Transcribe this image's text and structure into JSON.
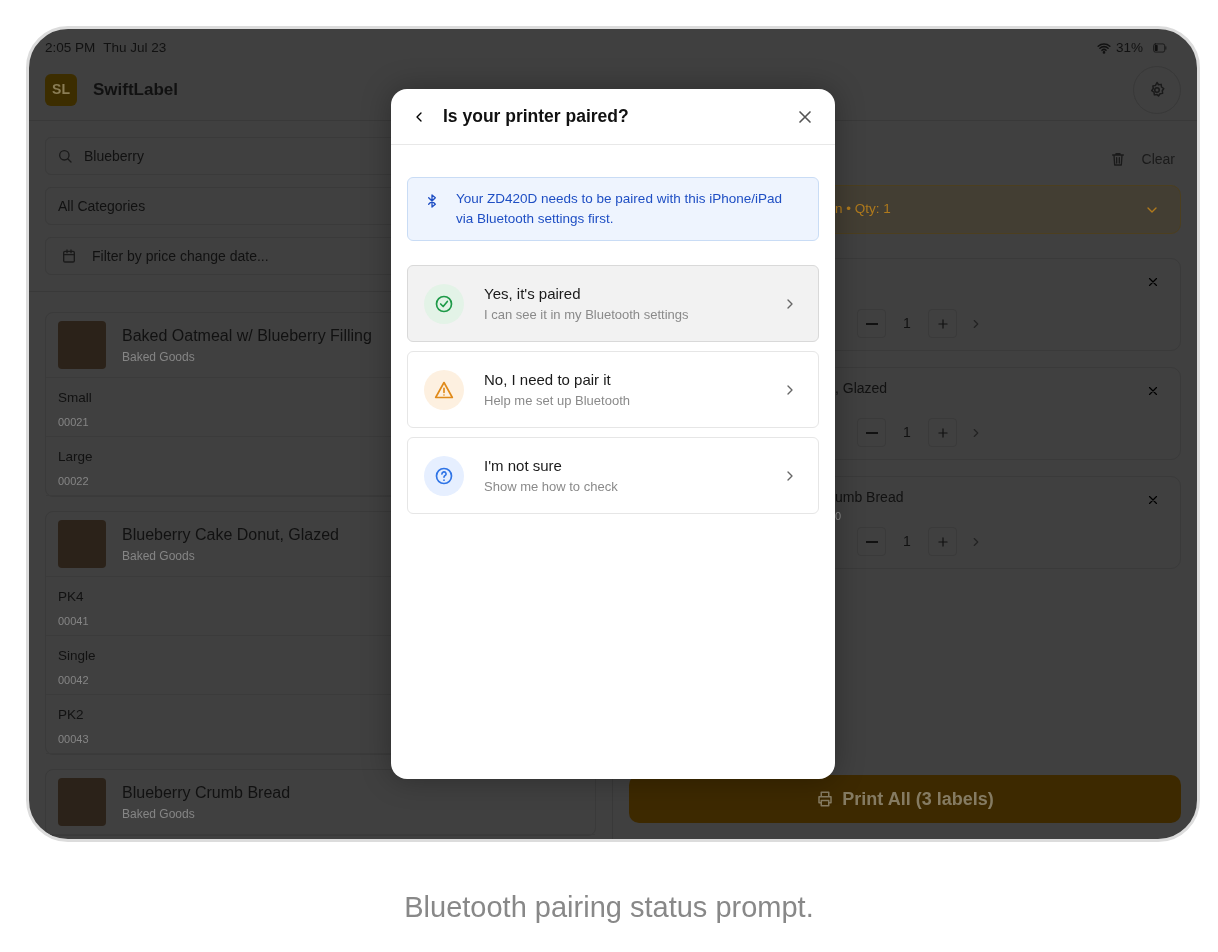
{
  "status_bar": {
    "time": "2:05 PM",
    "date": "Thu Jul 23",
    "battery": "31%"
  },
  "app": {
    "logo_text": "SL",
    "title": "SwiftLabel"
  },
  "filters": {
    "search": {
      "value": "Blueberry"
    },
    "category": {
      "value": "All Categories"
    },
    "date_filter": {
      "placeholder": "Filter by price change date..."
    }
  },
  "products": [
    {
      "name": "Baked Oatmeal w/ Blueberry Filling",
      "category": "Baked Goods",
      "variants": [
        {
          "name": "Small",
          "code": "00021"
        },
        {
          "name": "Large",
          "code": "00022"
        }
      ]
    },
    {
      "name": "Blueberry Cake Donut, Glazed",
      "category": "Baked Goods",
      "variants": [
        {
          "name": "PK4",
          "code": "00041"
        },
        {
          "name": "Single",
          "code": "00042"
        },
        {
          "name": "PK2",
          "code": "00043"
        }
      ]
    },
    {
      "name": "Blueberry Crumb Bread",
      "category": "Baked Goods"
    }
  ],
  "cart": {
    "clear": "Clear",
    "summary": "n • Qty: 1",
    "items": [
      {
        "qty": "1"
      },
      {
        "title": ", Glazed",
        "qty": "1"
      },
      {
        "title": "umb Bread",
        "subtitle": "0",
        "qty": "1"
      }
    ],
    "print_button": "Print All (3 labels)"
  },
  "dialog": {
    "title": "Is your printer paired?",
    "info": "Your ZD420D needs to be paired with this iPhone/iPad via Bluetooth settings first.",
    "options": [
      {
        "kind": "check",
        "title": "Yes, it's paired",
        "subtitle": "I can see it in my Bluetooth settings",
        "selected": true
      },
      {
        "kind": "warning",
        "title": "No, I need to pair it",
        "subtitle": "Help me set up Bluetooth",
        "selected": false
      },
      {
        "kind": "question",
        "title": "I'm not sure",
        "subtitle": "Show me how to check",
        "selected": false
      }
    ]
  },
  "caption": "Bluetooth pairing status prompt."
}
